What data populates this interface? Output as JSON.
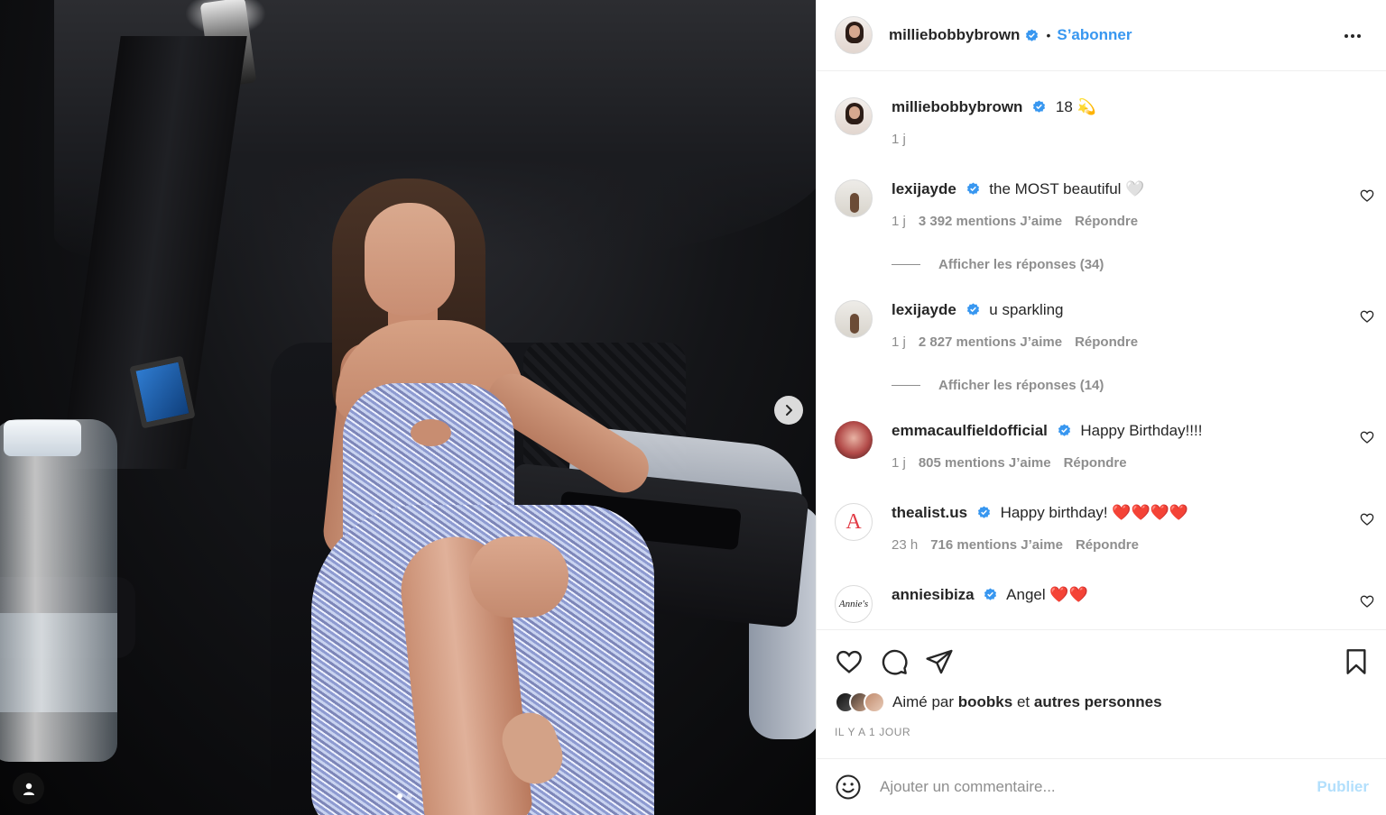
{
  "post": {
    "author": "milliebobbybrown",
    "follow_label": "S’abonner",
    "header_separator": "•",
    "caption_text": "18 💫",
    "caption_age": "1 j",
    "carousel": {
      "current": 1,
      "total": 2
    }
  },
  "comments": [
    {
      "user": "lexijayde",
      "text": "the MOST beautiful 🤍",
      "age": "1 j",
      "likes": "3 392 mentions J’aime",
      "reply_label": "Répondre",
      "replies_label": "Afficher les réponses (34)"
    },
    {
      "user": "lexijayde",
      "text": "u sparkling",
      "age": "1 j",
      "likes": "2 827 mentions J’aime",
      "reply_label": "Répondre",
      "replies_label": "Afficher les réponses (14)"
    },
    {
      "user": "emmacaulfieldofficial",
      "text": "Happy Birthday!!!!",
      "age": "1 j",
      "likes": "805 mentions J’aime",
      "reply_label": "Répondre"
    },
    {
      "user": "thealist.us",
      "text": "Happy birthday! ❤️❤️❤️❤️",
      "age": "23 h",
      "likes": "716 mentions J’aime",
      "reply_label": "Répondre",
      "avatar_text": "A"
    },
    {
      "user": "anniesibiza",
      "text": "Angel ❤️❤️",
      "avatar_text": "Annie's"
    }
  ],
  "likes_summary": {
    "prefix": "Aimé par",
    "user": "boobks",
    "conjunction": "et",
    "others": "autres personnes"
  },
  "timestamp": "IL Y A 1 JOUR",
  "comment_input": {
    "placeholder": "Ajouter un commentaire...",
    "publish_label": "Publier"
  },
  "colors": {
    "accent": "#3897f0",
    "verified": "#3897f0",
    "publish_disabled": "#b2dffc",
    "muted_text": "#8e8e8e"
  },
  "icons": [
    "chevron-right-icon",
    "user-tag-icon",
    "verified-icon",
    "more-icon",
    "heart-icon",
    "comment-icon",
    "share-icon",
    "bookmark-icon",
    "emoji-icon"
  ]
}
